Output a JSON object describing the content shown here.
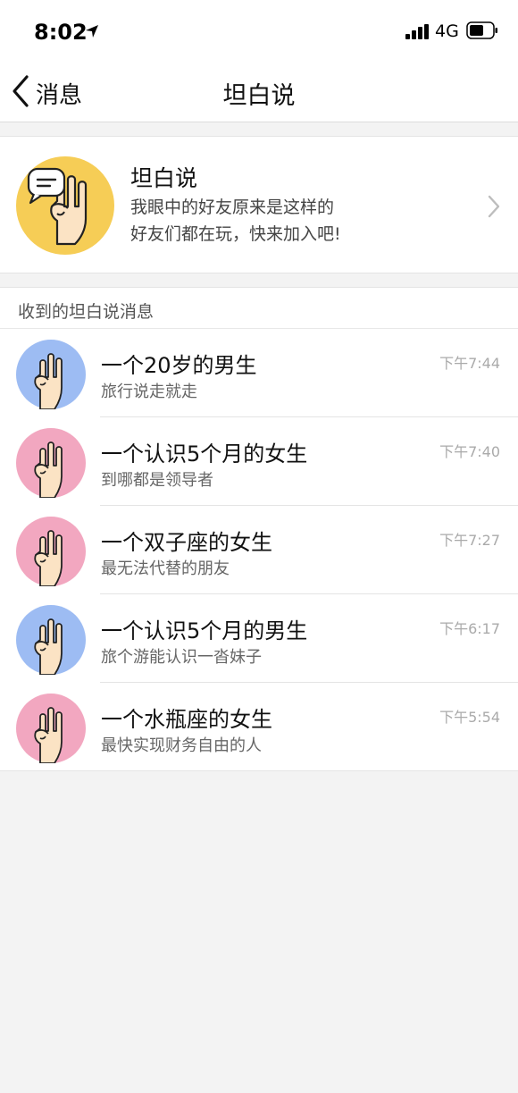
{
  "status_bar": {
    "time": "8:02",
    "network": "4G"
  },
  "nav": {
    "back_label": "消息",
    "title": "坦白说"
  },
  "promo": {
    "title": "坦白说",
    "line1": "我眼中的好友原来是这样的",
    "line2": "好友们都在玩，快来加入吧!"
  },
  "section": {
    "label": "收到的坦白说消息"
  },
  "colors": {
    "promo_avatar": "#f6cd56",
    "male_avatar": "#9dbcf3",
    "female_avatar": "#f2a7c0",
    "hand_fill": "#fbe3c4"
  },
  "messages": [
    {
      "title": "一个20岁的男生",
      "subtitle": "旅行说走就走",
      "time": "下午7:44",
      "avatar": "male"
    },
    {
      "title": "一个认识5个月的女生",
      "subtitle": "到哪都是领导者",
      "time": "下午7:40",
      "avatar": "female"
    },
    {
      "title": "一个双子座的女生",
      "subtitle": "最无法代替的朋友",
      "time": "下午7:27",
      "avatar": "female"
    },
    {
      "title": "一个认识5个月的男生",
      "subtitle": "旅个游能认识一沓妹子",
      "time": "下午6:17",
      "avatar": "male"
    },
    {
      "title": "一个水瓶座的女生",
      "subtitle": "最快实现财务自由的人",
      "time": "下午5:54",
      "avatar": "female"
    }
  ]
}
